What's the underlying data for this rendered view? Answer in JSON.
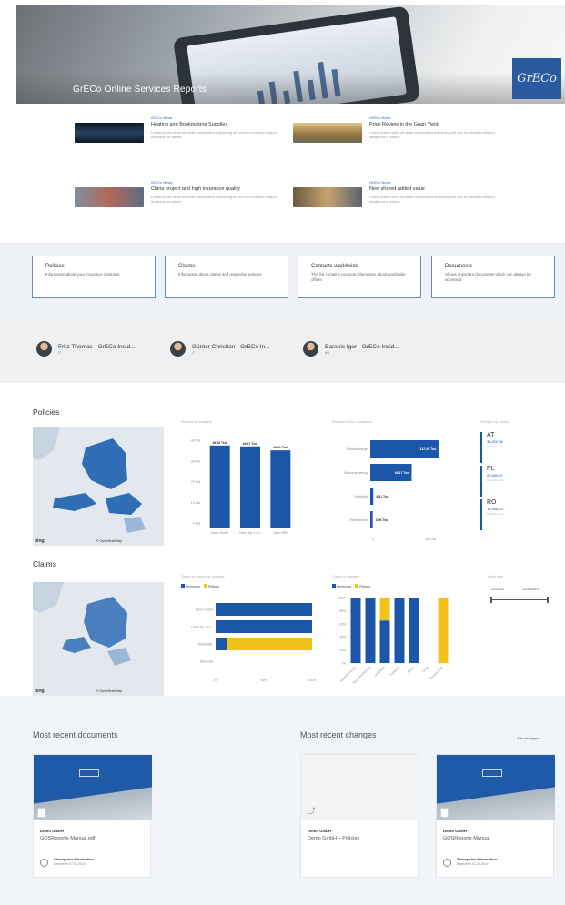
{
  "hero": {
    "title": "GrECo Online Services Reports",
    "logo_text": "GrECo"
  },
  "news": [
    {
      "category": "GrECo News",
      "title": "Heating and Bookmaking Supplies",
      "desc": "Lorem ipsum dolor sit amet consectetur adipiscing elit sed do eiusmod tempor incididunt ut labore"
    },
    {
      "category": "GrECo News",
      "title": "Price Review in the Grain Yield",
      "desc": "Lorem ipsum dolor sit amet consectetur adipiscing elit sed do eiusmod tempor incididunt ut labore"
    },
    {
      "category": "GrECo News",
      "title": "China project and high insurance quality",
      "desc": "Lorem ipsum dolor sit amet consectetur adipiscing elit sed do eiusmod tempor incididunt ut labore"
    },
    {
      "category": "GrECo News",
      "title": "New shared added value",
      "desc": "Lorem ipsum dolor sit amet consectetur adipiscing elit sed do eiusmod tempor incididunt ut labore"
    }
  ],
  "quick_links": [
    {
      "title": "Policies",
      "desc": "Information about your insurance contracts"
    },
    {
      "title": "Claims",
      "desc": "Information about claims and respective policies"
    },
    {
      "title": "Contacts worldwide",
      "desc": "This list contains contacts information about worldwide offices"
    },
    {
      "title": "Documents",
      "desc": "Shows important documents which can always be accessed"
    }
  ],
  "people": [
    {
      "name": "Fritz Thomas - GrECo Insid...",
      "sub": "IT"
    },
    {
      "name": "Günter Christian - GrECo In...",
      "sub": "IT"
    },
    {
      "name": "Baranic Igor - GrECo Insid...",
      "sub": "BG"
    }
  ],
  "policies": {
    "title": "Policies",
    "map_attr": "© OpenStreetMap",
    "map_logo": "bing",
    "bar_panel_title": "Premium by company",
    "hbar_panel_title": "Premium by line of business",
    "kpi_panel_title": "Premium by country",
    "kpis": [
      {
        "code": "AT",
        "value": "34,820.86",
        "label": "Premium sum"
      },
      {
        "code": "PL",
        "value": "22,650.97",
        "label": "Premium sum"
      },
      {
        "code": "RO",
        "value": "15,498.23",
        "label": "Premium sum"
      }
    ]
  },
  "claims": {
    "title": "Claims",
    "map_attr": "© OpenStreetMap",
    "map_logo": "bing",
    "hbar_panel_title": "Claims by status and company",
    "stack_panel_title": "Claims by category",
    "legend": [
      "Rechnung",
      "Prüfung"
    ],
    "range_title": "Claim date",
    "range_start": "1/1/2013",
    "range_end": "12/31/2019"
  },
  "bottom": {
    "docs_title": "Most recent documents",
    "changes_title": "Most recent changes",
    "see_all": "Alle anzeigen",
    "cards": [
      {
        "library": "Demo GmbH",
        "file": "GOSReports-Manual.pdf",
        "author": "Sharepoint Automation",
        "date": "Bearbeitet 07.03.2019"
      },
      {
        "library": "Demo GmbH",
        "file": "Demo GmbH – Policies",
        "author": "",
        "date": ""
      },
      {
        "library": "Demo GmbH",
        "file": "GOSReports-Manual",
        "author": "Sharepoint Automation",
        "date": "Bearbeitet 01.04.2019"
      }
    ]
  },
  "colors": {
    "primary": "#1c56a8",
    "accent": "#f2c21b",
    "panel_bg": "#eef2f7"
  },
  "chart_data": [
    {
      "type": "bar",
      "categories": [
        "Demo GmbH",
        "Demo Sp. z o.o.",
        "Demo SRL"
      ],
      "values": [
        46.98,
        46.47,
        44.19
      ],
      "data_labels": [
        "46.98 Tsd.",
        "46.47 Tsd.",
        "44.19 Tsd."
      ],
      "yticks": [
        "40 Tsd.",
        "30 Tsd.",
        "20 Tsd.",
        "10 Tsd.",
        "0 Tsd."
      ],
      "ylim": [
        0,
        50
      ]
    },
    {
      "type": "bar",
      "orientation": "horizontal",
      "categories": [
        "Motorfahrzeuge",
        "Sachversicherung",
        "Haftpflicht",
        "Rechtsschutz"
      ],
      "values": [
        112.39,
        68.17,
        4.81,
        3.96
      ],
      "data_labels": [
        "112.39 Tsd.",
        "68.17 Tsd.",
        "4.81 Tsd.",
        "3.96 Tsd."
      ],
      "xticks": [
        "0",
        "100 Tsd."
      ],
      "xlim": [
        0,
        120
      ]
    },
    {
      "type": "bar",
      "orientation": "horizontal",
      "stacked": true,
      "categories": [
        "Demo GmbH",
        "Demo Sp. z o.o.",
        "Demo SRL",
        "Demo AD"
      ],
      "series": [
        {
          "name": "Rechnung",
          "values": [
            100,
            100,
            12,
            0
          ]
        },
        {
          "name": "Prüfung",
          "values": [
            0,
            0,
            88,
            0
          ]
        }
      ],
      "xticks": [
        "0%",
        "50%",
        "100%"
      ],
      "xlim": [
        0,
        100
      ]
    },
    {
      "type": "bar",
      "stacked": true,
      "categories": [
        "Motorfahrzeuge",
        "Sachversicherung",
        "Haftpflicht",
        "Transport",
        "Kasko",
        "Unfall",
        "Rechtsschutz"
      ],
      "series": [
        {
          "name": "Rechnung",
          "values": [
            100,
            100,
            65,
            100,
            100,
            0,
            0
          ]
        },
        {
          "name": "Prüfung",
          "values": [
            0,
            0,
            35,
            0,
            0,
            0,
            100
          ]
        }
      ],
      "yticks": [
        "100%",
        "80%",
        "60%",
        "40%",
        "20%",
        "0%"
      ],
      "ylim": [
        0,
        100
      ]
    }
  ]
}
